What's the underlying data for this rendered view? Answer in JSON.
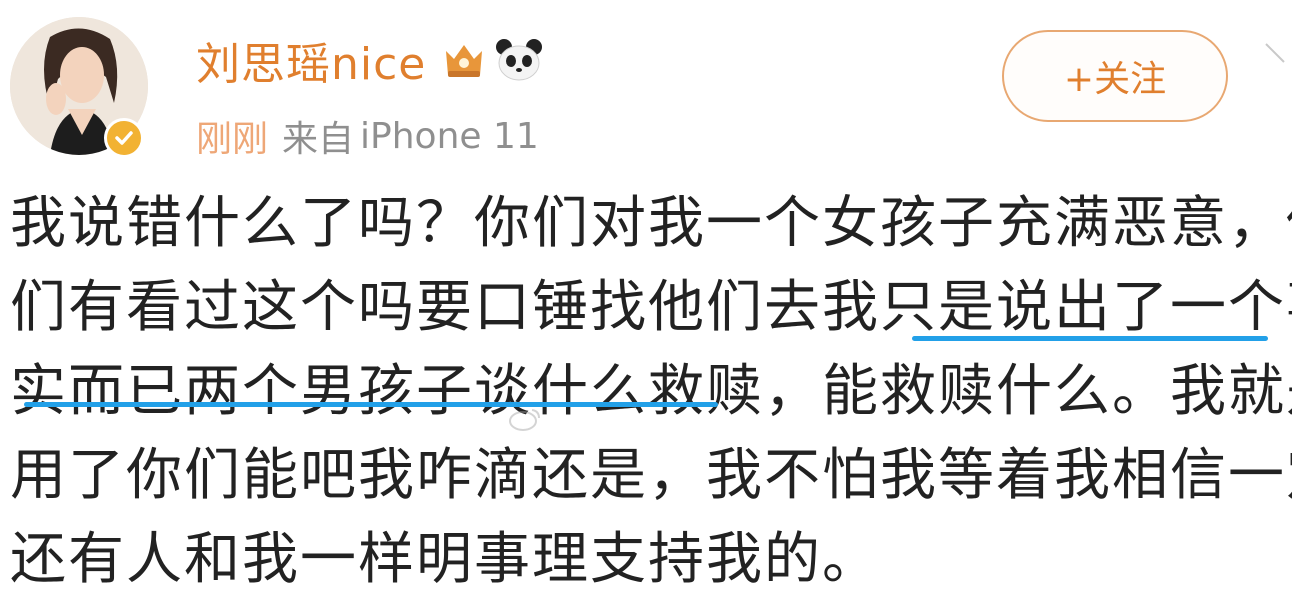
{
  "user": {
    "name": "刘思瑶nice",
    "avatar_icon": "portrait-avatar",
    "badge_icon": "verified-badge-icon",
    "vip_icon": "vip-crown-icon",
    "panda_icon": "panda-emoji-icon"
  },
  "meta": {
    "time": "刚刚",
    "source_prefix": "来自",
    "device": "iPhone 11"
  },
  "follow_button": {
    "label": "+关注"
  },
  "post": {
    "lines": [
      "我说错什么了吗？你们对我一个女孩子充满恶意，你",
      "们有看过这个吗要口锤找他们去我只是说出了一个事",
      "实而已两个男孩子谈什么救赎，能救赎什么。我就是",
      "用了你们能吧我咋滴还是，我不怕我等着我相信一定",
      "还有人和我一样明事理支持我的。"
    ]
  },
  "colors": {
    "username": "#e07f2e",
    "underline": "#22a0e8",
    "text": "#222222",
    "meta": "#8f8f8f"
  }
}
